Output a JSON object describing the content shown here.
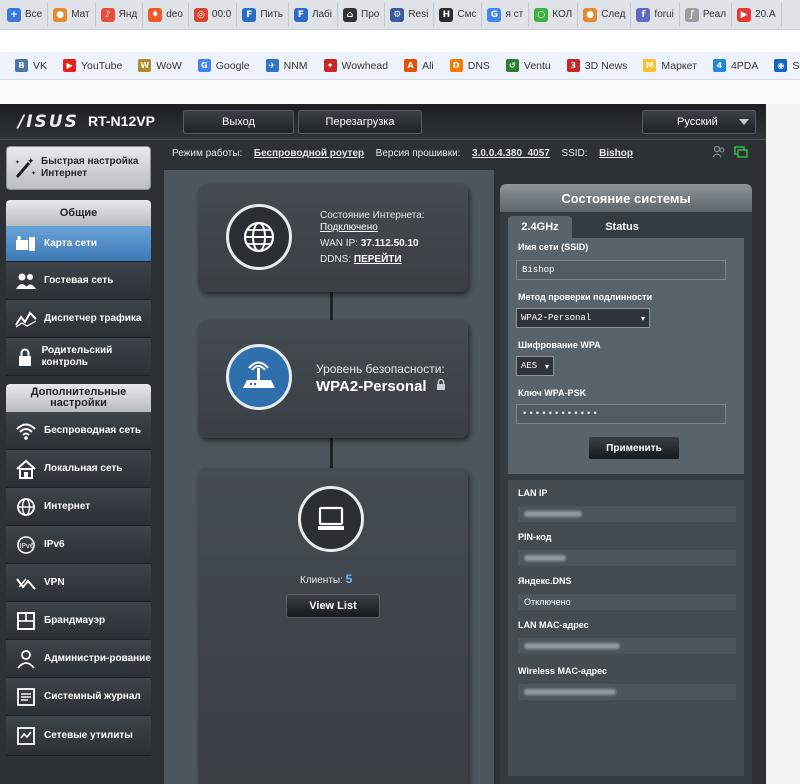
{
  "browser_tabs": [
    {
      "label": "Все",
      "color": "#3a78d8",
      "glyph": "+"
    },
    {
      "label": "Мат",
      "color": "#e68a2e",
      "glyph": "●"
    },
    {
      "label": "Янд",
      "color": "#e84c3d",
      "glyph": "♪"
    },
    {
      "label": "deo",
      "color": "#ef5a2a",
      "glyph": "♦"
    },
    {
      "label": "00:0",
      "color": "#d9442f",
      "glyph": "◎"
    },
    {
      "label": "Пить",
      "color": "#2a6cc7",
      "glyph": "F"
    },
    {
      "label": "Лабі",
      "color": "#2a6cc7",
      "glyph": "F"
    },
    {
      "label": "Про",
      "color": "#333333",
      "glyph": "⌂"
    },
    {
      "label": "Resi",
      "color": "#3a5ba0",
      "glyph": "⚙"
    },
    {
      "label": "Смс",
      "color": "#2c2c2c",
      "glyph": "H"
    },
    {
      "label": "я ст",
      "color": "#4285f4",
      "glyph": "G"
    },
    {
      "label": "КОЛ",
      "color": "#3cb043",
      "glyph": "○"
    },
    {
      "label": "След",
      "color": "#e68a2e",
      "glyph": "●"
    },
    {
      "label": "forui",
      "color": "#5c6bc0",
      "glyph": "f"
    },
    {
      "label": "Реал",
      "color": "#9e9e9e",
      "glyph": "∫"
    },
    {
      "label": "20.А",
      "color": "#e53935",
      "glyph": "▶"
    }
  ],
  "bookmarks": [
    {
      "label": "VK",
      "color": "#4a76a8",
      "glyph": "В"
    },
    {
      "label": "YouTube",
      "color": "#e62117",
      "glyph": "▶"
    },
    {
      "label": "WoW",
      "color": "#b08a2a",
      "glyph": "W"
    },
    {
      "label": "Google",
      "color": "#4285f4",
      "glyph": "G"
    },
    {
      "label": "NNM",
      "color": "#2f75c0",
      "glyph": "✈"
    },
    {
      "label": "Wowhead",
      "color": "#c62828",
      "glyph": "✦"
    },
    {
      "label": "Ali",
      "color": "#e65100",
      "glyph": "A"
    },
    {
      "label": "DNS",
      "color": "#f57c00",
      "glyph": "D"
    },
    {
      "label": "Ventu",
      "color": "#2e7d32",
      "glyph": "↺"
    },
    {
      "label": "3D News",
      "color": "#c62828",
      "glyph": "3"
    },
    {
      "label": "Маркет",
      "color": "#fbc02d",
      "glyph": "М"
    },
    {
      "label": "4PDA",
      "color": "#1e88e5",
      "glyph": "4"
    },
    {
      "label": "Solar Scope",
      "color": "#1565c0",
      "glyph": "◉"
    }
  ],
  "header": {
    "logo": "/ISUS",
    "model": "RT-N12VP",
    "logout": "Выход",
    "reboot": "Перезагрузка",
    "language": "Русский"
  },
  "quick_setup": "Быстрая настройка Интернет",
  "nav": {
    "general_title": "Общие",
    "general": [
      {
        "label": "Карта сети",
        "icon": "network-map-icon",
        "active": true
      },
      {
        "label": "Гостевая сеть",
        "icon": "guest-network-icon",
        "active": false
      },
      {
        "label": "Диспетчер трафика",
        "icon": "traffic-manager-icon",
        "active": false
      },
      {
        "label": "Родительский контроль",
        "icon": "parental-control-icon",
        "active": false
      }
    ],
    "advanced_title": "Дополнительные настройки",
    "advanced": [
      {
        "label": "Беспроводная сеть",
        "icon": "wireless-icon"
      },
      {
        "label": "Локальная сеть",
        "icon": "home-icon"
      },
      {
        "label": "Интернет",
        "icon": "globe-icon"
      },
      {
        "label": "IPv6",
        "icon": "ipv6-icon"
      },
      {
        "label": "VPN",
        "icon": "vpn-icon"
      },
      {
        "label": "Брандмауэр",
        "icon": "firewall-icon"
      },
      {
        "label": "Администри-рование",
        "icon": "admin-icon"
      },
      {
        "label": "Системный журнал",
        "icon": "system-log-icon"
      },
      {
        "label": "Сетевые утилиты",
        "icon": "network-tools-icon"
      }
    ]
  },
  "modebar": {
    "mode_label": "Режим работы:",
    "mode_value": "Беспроводной роутер",
    "firmware_label": "Версия прошивки:",
    "firmware_value": "3.0.0.4.380_4057",
    "ssid_label": "SSID:",
    "ssid_value": "Bishop"
  },
  "internet_card": {
    "status_label": "Состояние Интернета:",
    "status_value": "Подключено",
    "wan_label": "WAN IP:",
    "wan_value": "37.112.50.10",
    "ddns_label": "DDNS:",
    "ddns_value": "ПЕРЕЙТИ"
  },
  "security_card": {
    "level_label": "Уровень безопасности:",
    "level_value": "WPA2-Personal"
  },
  "clients_card": {
    "label": "Клиенты:",
    "count": "5",
    "button": "View List"
  },
  "system_status": {
    "title": "Состояние системы",
    "tab_24": "2.4GHz",
    "tab_status": "Status",
    "ssid_label": "Имя сети (SSID)",
    "ssid_value": "Bishop",
    "auth_label": "Метод проверки подлинности",
    "auth_value": "WPA2-Personal",
    "enc_label": "Шифрование WPA",
    "enc_value": "AES",
    "psk_label": "Ключ WPA-PSK",
    "psk_value": "••••••••••••",
    "apply": "Применить",
    "lan_ip_label": "LAN IP",
    "pin_label": "PIN-код",
    "yandex_label": "Яндекс.DNS",
    "yandex_value": "Отключено",
    "lan_mac_label": "LAN MAC-адрес",
    "wl_mac_label": "Wireless MAC-адрес"
  }
}
